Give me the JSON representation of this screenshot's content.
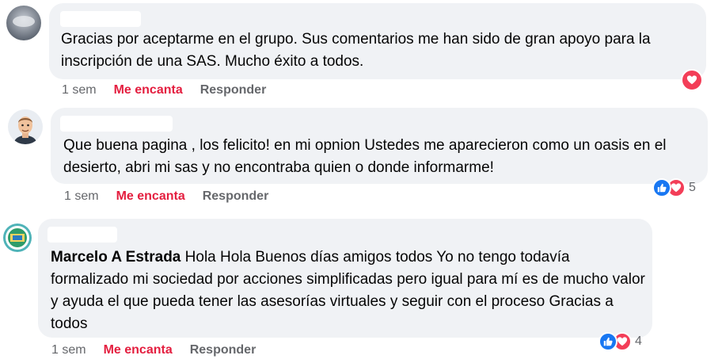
{
  "comments": [
    {
      "author": "",
      "text": "Gracias por aceptarme en el grupo. Sus comentarios me han sido de gran apoyo para la inscripción de una SAS. Mucho éxito a todos.",
      "time": "1 sem",
      "love_label": "Me encanta",
      "reply_label": "Responder",
      "reactions": [
        "love"
      ],
      "reaction_count": ""
    },
    {
      "author": "",
      "text": "Que buena pagina , los felicito! en mi opnion Ustedes me aparecieron como un oasis en el desierto, abri mi sas y no encontraba quien o donde informarme!",
      "time": "1 sem",
      "love_label": "Me encanta",
      "reply_label": "Responder",
      "reactions": [
        "like",
        "love"
      ],
      "reaction_count": "5"
    },
    {
      "author": "",
      "mention": "Marcelo A Estrada",
      "text": "Hola Hola Buenos días amigos todos Yo no tengo todavía formalizado mi sociedad por acciones simplificadas pero igual para mí es de mucho valor y ayuda el que pueda tener las asesorías virtuales y seguir con el proceso Gracias a todos",
      "time": "1 sem",
      "love_label": "Me encanta",
      "reply_label": "Responder",
      "reactions": [
        "like",
        "love"
      ],
      "reaction_count": "4"
    }
  ],
  "colors": {
    "bubble": "#f0f2f5",
    "love": "#e41e3f",
    "like": "#1877f2",
    "meta": "#65676b"
  }
}
